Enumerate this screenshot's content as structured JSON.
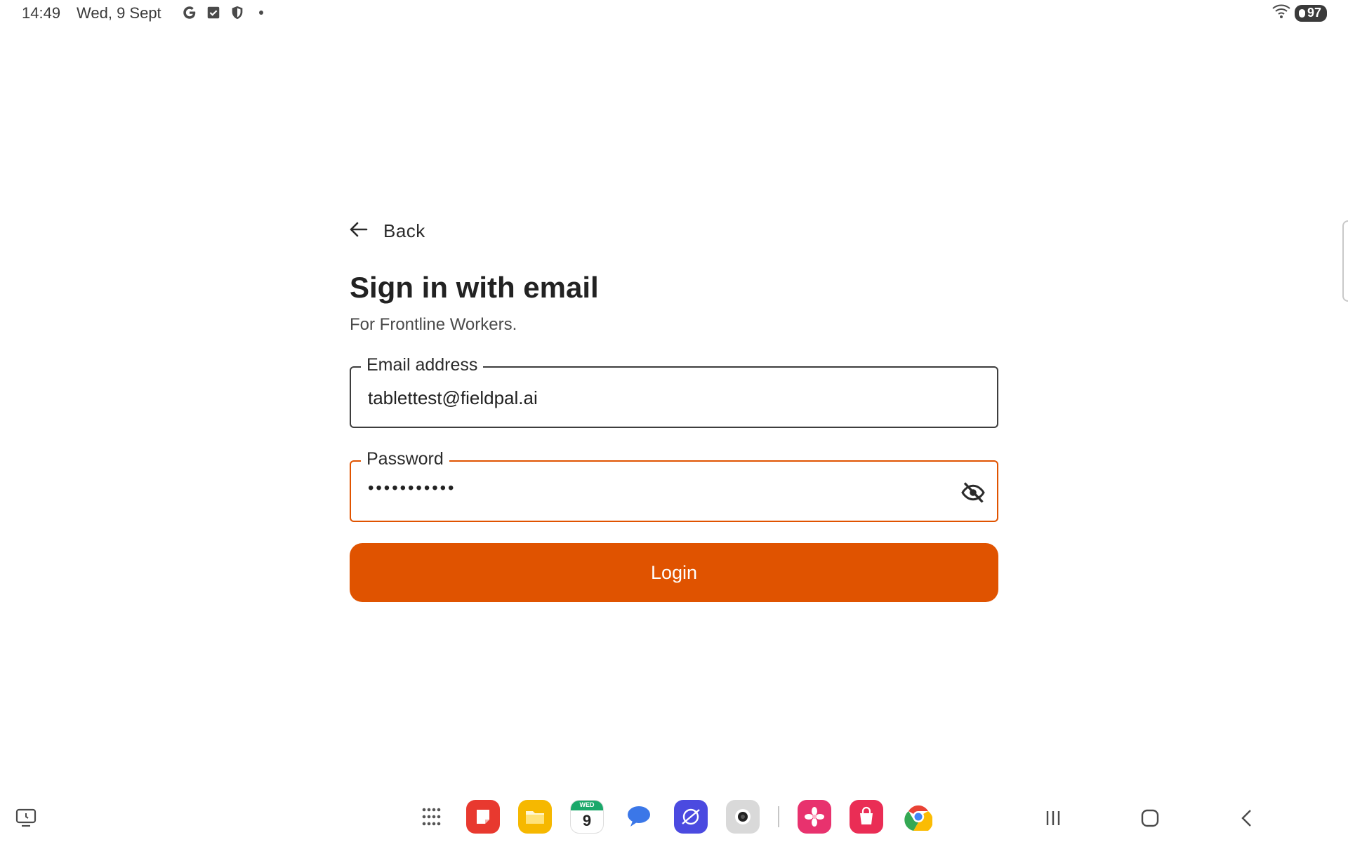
{
  "status_bar": {
    "time": "14:49",
    "date": "Wed, 9 Sept",
    "icons": [
      "google-icon",
      "checkbox-icon",
      "shield-icon",
      "notification-dot-icon"
    ],
    "right_icons": [
      "wifi-icon",
      "battery-icon"
    ],
    "battery_level": "97"
  },
  "form": {
    "back_label": "Back",
    "title": "Sign in with email",
    "subtitle": "For Frontline Workers.",
    "email": {
      "label": "Email address",
      "value": "tablettest@fieldpal.ai"
    },
    "password": {
      "label": "Password",
      "value": "•••••••••••",
      "toggle_icon": "eye-off-icon"
    },
    "login_label": "Login"
  },
  "taskbar": {
    "calendar_day": "WED",
    "calendar_date": "9",
    "apps": [
      "app-drawer-icon",
      "notes-app-icon",
      "files-app-icon",
      "calendar-app-icon",
      "messages-app-icon",
      "internet-app-icon",
      "camera-app-icon",
      "gallery-app-icon",
      "store-app-icon",
      "chrome-app-icon"
    ],
    "nav": [
      "recents-button",
      "home-button",
      "back-button"
    ]
  },
  "colors": {
    "accent": "#e05300",
    "text": "#222222",
    "border": "#3d3d3d"
  }
}
